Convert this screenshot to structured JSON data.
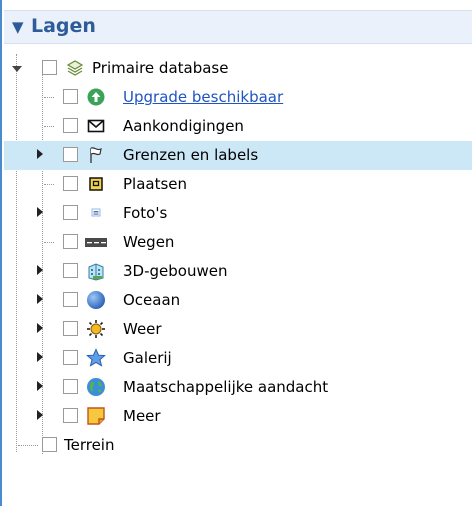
{
  "panel": {
    "title": "Lagen"
  },
  "tree": {
    "root_label": "Primaire database",
    "items": [
      {
        "label": "Upgrade beschikbaar",
        "icon": "upgrade-arrow-icon"
      },
      {
        "label": "Aankondigingen",
        "icon": "envelope-icon"
      },
      {
        "label": "Grenzen en labels",
        "icon": "flag-icon"
      },
      {
        "label": "Plaatsen",
        "icon": "place-square-icon"
      },
      {
        "label": "Foto's",
        "icon": "photo-icon"
      },
      {
        "label": "Wegen",
        "icon": "road-icon"
      },
      {
        "label": "3D-gebouwen",
        "icon": "building-icon"
      },
      {
        "label": "Oceaan",
        "icon": "ocean-globe-icon"
      },
      {
        "label": "Weer",
        "icon": "sun-icon"
      },
      {
        "label": "Galerij",
        "icon": "star-icon"
      },
      {
        "label": "Maatschappelijke aandacht",
        "icon": "earth-icon"
      },
      {
        "label": "Meer",
        "icon": "sticky-note-icon"
      }
    ],
    "terrain_label": "Terrein"
  },
  "colors": {
    "accent": "#2e5c9a",
    "selection": "#cce8f7",
    "link": "#1f54c4"
  }
}
